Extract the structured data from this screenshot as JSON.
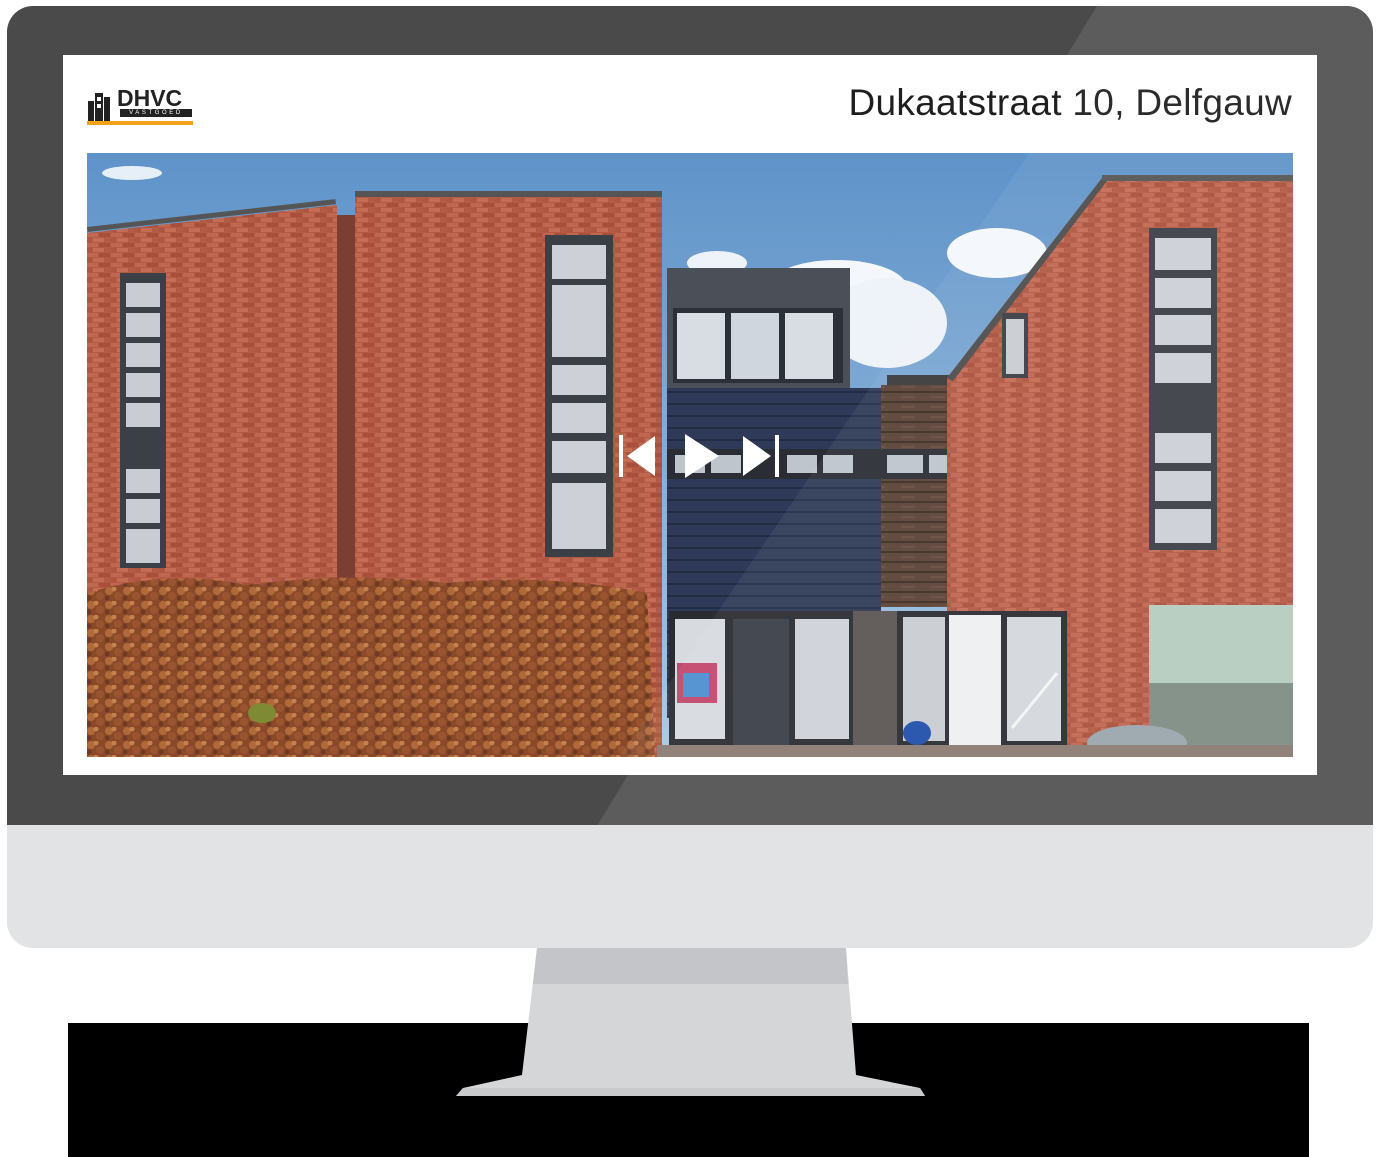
{
  "window": {
    "title": "Dukaatstraat 10, Delfgauw"
  },
  "brand": {
    "name": "DHVC",
    "tagline": "VASTGOED",
    "accent_color": "#f2a31b",
    "logo_icon": "building-icon"
  },
  "slideshow": {
    "image_description_icon": "house-photo",
    "controls": {
      "previous_icon": "skip-previous-icon",
      "play_icon": "play-icon",
      "next_icon": "skip-next-icon"
    }
  },
  "colors": {
    "bezel": "#4a4a4a",
    "chin": "#e2e3e5",
    "stand": "#d4d6d8",
    "desk": "#000000"
  }
}
